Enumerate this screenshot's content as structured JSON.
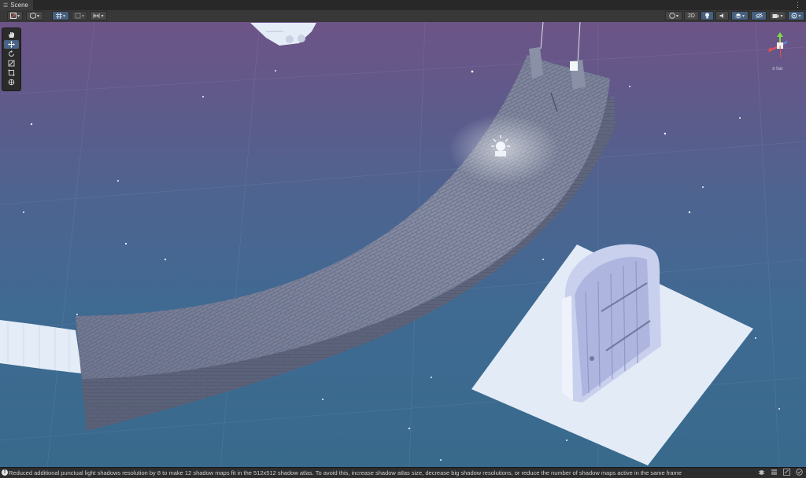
{
  "window": {
    "tab_title": "Scene",
    "kebab": "⋮"
  },
  "toolbar": {
    "two_d_label": "2D"
  },
  "tools": {
    "items": [
      "view-tool",
      "move-tool",
      "rotate-tool",
      "scale-tool",
      "rect-tool",
      "transform-tool"
    ],
    "selected": "move-tool"
  },
  "gizmo": {
    "projection_label": "≡ Iso"
  },
  "status": {
    "message": "Reduced additional punctual light shadows resolution by 8 to make 12 shadow maps fit in the 512x512 shadow atlas. To avoid this, increase shadow atlas size, decrease big shadow resolutions, or reduce the number of shadow maps active in the same frame"
  },
  "colors": {
    "sky_top": "#6d5487",
    "sky_bottom": "#386a8c",
    "stone": "#7f879c",
    "plane": "#dfe9f6",
    "panel": "#383838",
    "selected_tool": "#4a6486"
  }
}
